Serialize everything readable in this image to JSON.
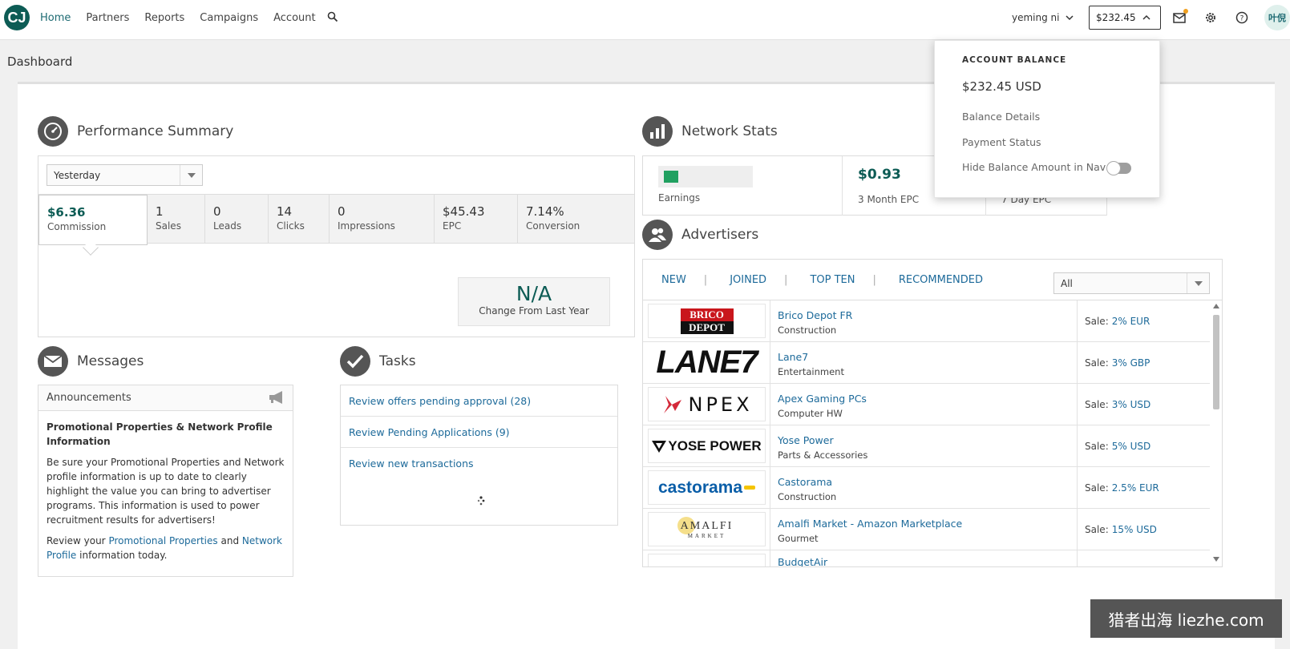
{
  "nav": {
    "logo_text": "CJ",
    "links": [
      "Home",
      "Partners",
      "Reports",
      "Campaigns",
      "Account"
    ],
    "user_name": "yeming ni",
    "balance": "$232.45",
    "avatar": "叶倪"
  },
  "page_title": "Dashboard",
  "performance": {
    "title": "Performance Summary",
    "period": "Yesterday",
    "kpis": [
      {
        "value": "$6.36",
        "label": "Commission"
      },
      {
        "value": "1",
        "label": "Sales"
      },
      {
        "value": "0",
        "label": "Leads"
      },
      {
        "value": "14",
        "label": "Clicks"
      },
      {
        "value": "0",
        "label": "Impressions"
      },
      {
        "value": "$45.43",
        "label": "EPC"
      },
      {
        "value": "7.14%",
        "label": "Conversion"
      }
    ],
    "change_value": "N/A",
    "change_label": "Change From Last Year"
  },
  "messages": {
    "title": "Messages",
    "announcements_label": "Announcements",
    "ann_title": "Promotional Properties & Network Profile Information",
    "ann_text": "Be sure your Promotional Properties and Network profile information is up to date to clearly highlight the value you can bring to advertiser programs. This information is used to power recruitment results for advertisers!",
    "review_prefix": "Review your",
    "link1": "Promotional Properties",
    "and": "and",
    "link2": "Network Profile",
    "review_suffix": "information today."
  },
  "tasks": {
    "title": "Tasks",
    "items": [
      "Review offers pending approval (28)",
      "Review Pending Applications (9)",
      "Review new transactions"
    ]
  },
  "network_stats": {
    "title": "Network Stats",
    "earnings_label": "Earnings",
    "epc3_value": "$0.93",
    "epc3_label": "3 Month EPC",
    "epc7_label": "7 Day EPC"
  },
  "advertisers": {
    "title": "Advertisers",
    "tabs": [
      "NEW",
      "JOINED",
      "TOP TEN",
      "RECOMMENDED"
    ],
    "filter": "All",
    "rows": [
      {
        "logo": "BRICO DEPOT",
        "name": "Brico Depot FR",
        "category": "Construction",
        "sale_label": "Sale:",
        "sale": "2% EUR"
      },
      {
        "logo": "LANE7",
        "name": "Lane7",
        "category": "Entertainment",
        "sale_label": "Sale:",
        "sale": "3% GBP"
      },
      {
        "logo": "NPEX",
        "name": "Apex Gaming PCs",
        "category": "Computer HW",
        "sale_label": "Sale:",
        "sale": "3% USD"
      },
      {
        "logo": "YOSE POWER",
        "name": "Yose Power",
        "category": "Parts & Accessories",
        "sale_label": "Sale:",
        "sale": "5% USD"
      },
      {
        "logo": "castorama",
        "name": "Castorama",
        "category": "Construction",
        "sale_label": "Sale:",
        "sale": "2.5% EUR"
      },
      {
        "logo": "AMALFI MARKET",
        "name": "Amalfi Market - Amazon Marketplace",
        "category": "Gourmet",
        "sale_label": "Sale:",
        "sale": "15% USD"
      },
      {
        "logo": "BudgetAir",
        "name": "BudgetAir",
        "category": "",
        "sale_label": "",
        "sale": ""
      }
    ]
  },
  "balance_dropdown": {
    "heading": "ACCOUNT BALANCE",
    "amount": "$232.45 USD",
    "details": "Balance Details",
    "payment": "Payment Status",
    "hide": "Hide Balance Amount in Nav",
    "hide_enabled": false
  },
  "watermark": "猎者出海 liezhe.com",
  "colors": {
    "accent": "#0d5c55",
    "link": "#1d6a9a",
    "icon_bg": "#555555"
  }
}
